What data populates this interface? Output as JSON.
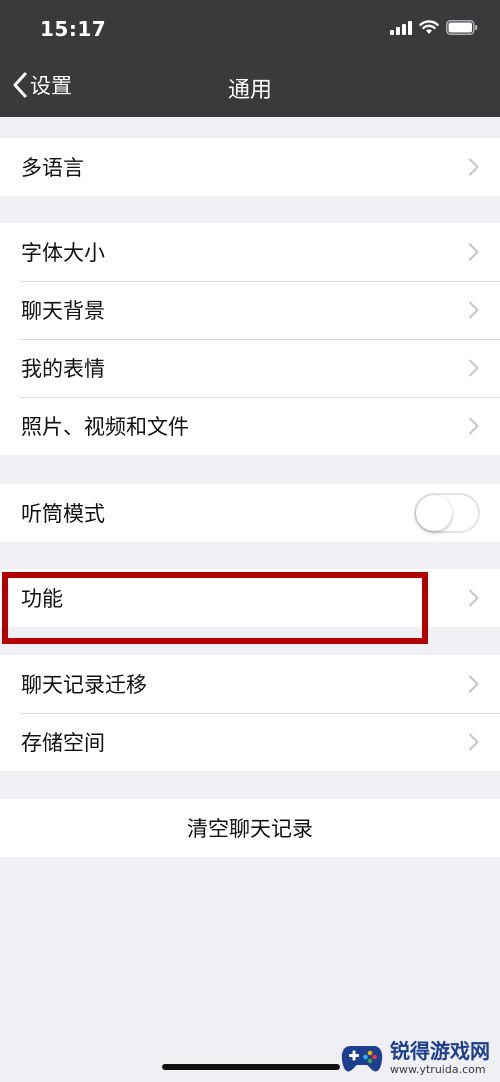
{
  "status_bar": {
    "time": "15:17"
  },
  "nav": {
    "back_label": "设置",
    "title": "通用"
  },
  "groups": {
    "language": [
      "多语言"
    ],
    "display": [
      "字体大小",
      "聊天背景",
      "我的表情",
      "照片、视频和文件"
    ],
    "earpiece": {
      "label": "听筒模式",
      "enabled": false
    },
    "features": [
      "功能"
    ],
    "storage": [
      "聊天记录迁移",
      "存储空间"
    ],
    "clear": "清空聊天记录"
  },
  "watermark": {
    "title": "锐得游戏网",
    "url": "www.ytruida.com"
  },
  "colors": {
    "header_bg": "#3a3a3c",
    "page_bg": "#efeff4",
    "highlight": "#b30000",
    "watermark_title": "#1d3f8f"
  },
  "icons": [
    "chevron-left-icon",
    "chevron-right-icon",
    "signal-icon",
    "wifi-icon",
    "battery-icon"
  ]
}
